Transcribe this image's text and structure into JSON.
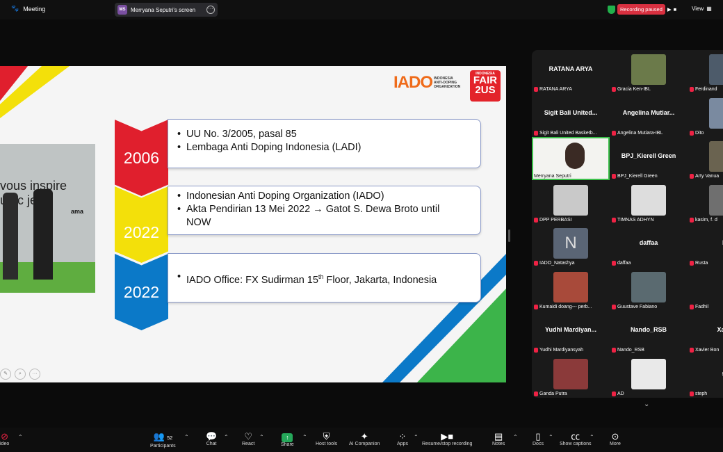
{
  "topbar": {
    "app_label": "Meeting",
    "share_initials": "MS",
    "share_label": "Merryana Seputri's screen",
    "recording_label": "Recording paused",
    "view_label": "View"
  },
  "slide": {
    "photo_text_line1": "vous inspire",
    "photo_text_line2": "ue    c jeu?",
    "photo_brand": "ama",
    "logo_main": "IADO",
    "logo_sub1": "INDONESIA",
    "logo_sub2": "ANTI-DOPING",
    "logo_sub3": "ORGANIZATION",
    "fair_top": "INDONESIA",
    "fair_main": "FAIR",
    "fair_num": "2US",
    "items": [
      {
        "year": "2006",
        "lines": [
          "UU No. 3/2005, pasal 85",
          "Lembaga Anti Doping Indonesia (LADI)"
        ]
      },
      {
        "year": "2022",
        "lines": [
          "Indonesian Anti Doping Organization (IADO)",
          "Akta Pendirian 13 Mei 2022 → Gatot S. Dewa Broto until NOW"
        ]
      },
      {
        "year": "2022",
        "lines": [
          "IADO Office: FX Sudirman 15th Floor, Jakarta, Indonesia"
        ]
      }
    ]
  },
  "participants": [
    {
      "name": "RATANA ARYA",
      "label": "RATANA ARYA"
    },
    {
      "name": "",
      "label": "Gracia Ken-IBL"
    },
    {
      "name": "",
      "label": "Ferdinand"
    },
    {
      "name": "Sigit Bali United...",
      "label": "Sigit Bali United Basketb..."
    },
    {
      "name": "Angelina Mutiar...",
      "label": "Angelina Mutiara-IBL"
    },
    {
      "name": "",
      "label": "Dito"
    },
    {
      "name": "",
      "label": "Merryana Seputri"
    },
    {
      "name": "BPJ_Kierell Green",
      "label": "BPJ_Kierell Green"
    },
    {
      "name": "",
      "label": "Arty Vanua"
    },
    {
      "name": "",
      "label": "DPP PERBASI"
    },
    {
      "name": "",
      "label": "TIMNAS ADHYN"
    },
    {
      "name": "",
      "label": "kasim, f. d"
    },
    {
      "name": "N",
      "label": "IADO_Natashya"
    },
    {
      "name": "daffaa",
      "label": "daffaa"
    },
    {
      "name": "Ru",
      "label": "Rusta"
    },
    {
      "name": "",
      "label": "Kumaidi doang--- perb..."
    },
    {
      "name": "",
      "label": "Guustave Fabiano"
    },
    {
      "name": "Fa",
      "label": "Fadhil"
    },
    {
      "name": "Yudhi Mardiyan...",
      "label": "Yudhi Mardiyansyah"
    },
    {
      "name": "Nando_RSB",
      "label": "Nando_RSB"
    },
    {
      "name": "Xavier",
      "label": "Xavier Bon"
    },
    {
      "name": "",
      "label": "Ganda Putra"
    },
    {
      "name": "",
      "label": "AD"
    },
    {
      "name": "ste",
      "label": "steph"
    }
  ],
  "toolbar": {
    "video": "ideo",
    "participants": "Participants",
    "participants_count": "52",
    "chat": "Chat",
    "react": "React",
    "share": "Share",
    "host_tools": "Host tools",
    "ai_companion": "AI Companion",
    "apps": "Apps",
    "recording": "Resume/stop recording",
    "notes": "Notes",
    "docs": "Docs",
    "captions": "Show captions",
    "more": "More"
  },
  "colors": {
    "red": "#e01f2d",
    "yellow": "#f3e00a",
    "blue": "#0b79c8",
    "green": "#3cc04b",
    "record": "#d93040"
  }
}
